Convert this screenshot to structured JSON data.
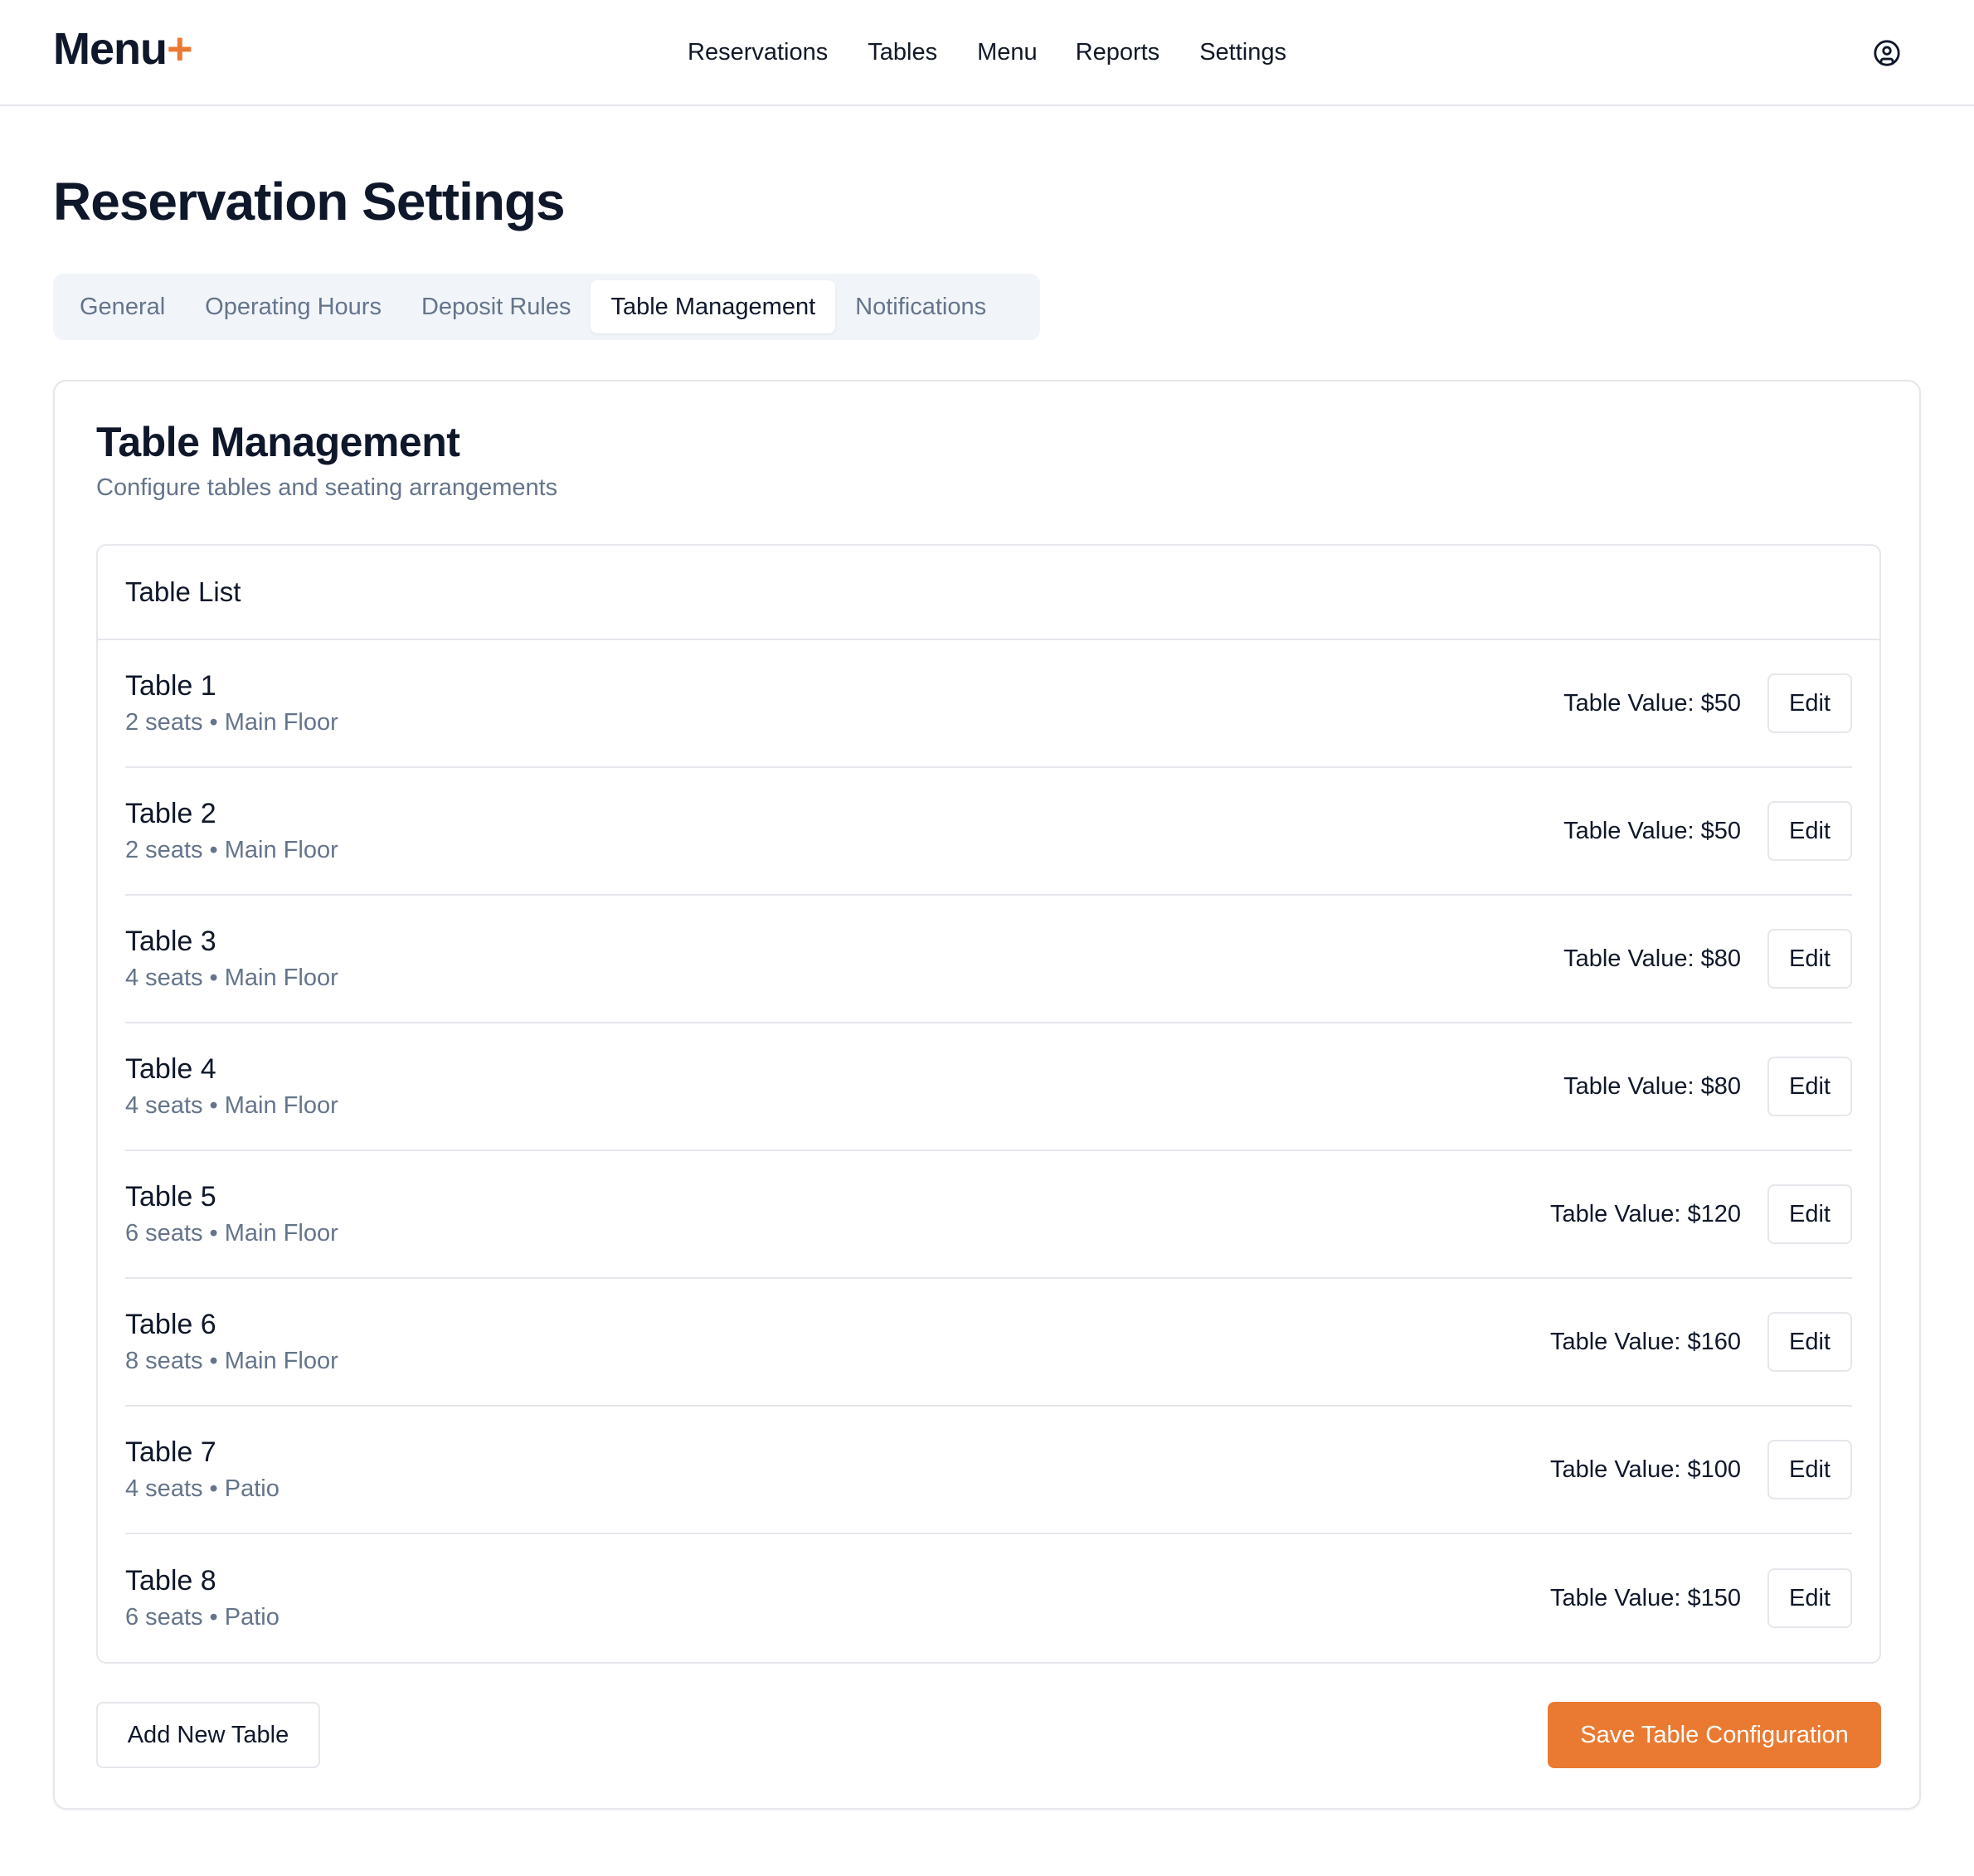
{
  "app": {
    "logo_text": "Menu",
    "logo_plus": "+"
  },
  "nav": {
    "items": [
      {
        "label": "Reservations"
      },
      {
        "label": "Tables"
      },
      {
        "label": "Menu"
      },
      {
        "label": "Reports"
      },
      {
        "label": "Settings"
      }
    ],
    "user_icon": "user-circle-icon"
  },
  "page": {
    "title": "Reservation Settings"
  },
  "tabs": [
    {
      "label": "General",
      "active": false
    },
    {
      "label": "Operating Hours",
      "active": false
    },
    {
      "label": "Deposit Rules",
      "active": false
    },
    {
      "label": "Table Management",
      "active": true
    },
    {
      "label": "Notifications",
      "active": false
    }
  ],
  "card": {
    "title": "Table Management",
    "subtitle": "Configure tables and seating arrangements",
    "list_header": "Table List",
    "tables": [
      {
        "name": "Table 1",
        "meta": "2 seats • Main Floor",
        "value": "Table Value: $50",
        "edit_label": "Edit"
      },
      {
        "name": "Table 2",
        "meta": "2 seats • Main Floor",
        "value": "Table Value: $50",
        "edit_label": "Edit"
      },
      {
        "name": "Table 3",
        "meta": "4 seats • Main Floor",
        "value": "Table Value: $80",
        "edit_label": "Edit"
      },
      {
        "name": "Table 4",
        "meta": "4 seats • Main Floor",
        "value": "Table Value: $80",
        "edit_label": "Edit"
      },
      {
        "name": "Table 5",
        "meta": "6 seats • Main Floor",
        "value": "Table Value: $120",
        "edit_label": "Edit"
      },
      {
        "name": "Table 6",
        "meta": "8 seats • Main Floor",
        "value": "Table Value: $160",
        "edit_label": "Edit"
      },
      {
        "name": "Table 7",
        "meta": "4 seats • Patio",
        "value": "Table Value: $100",
        "edit_label": "Edit"
      },
      {
        "name": "Table 8",
        "meta": "6 seats • Patio",
        "value": "Table Value: $150",
        "edit_label": "Edit"
      }
    ],
    "add_button_label": "Add New Table",
    "save_button_label": "Save Table Configuration"
  },
  "colors": {
    "accent": "#ea7a32",
    "text_primary": "#0f172a",
    "text_muted": "#64748b",
    "border": "#e5e7eb",
    "tabs_bg": "#f1f5f9"
  }
}
